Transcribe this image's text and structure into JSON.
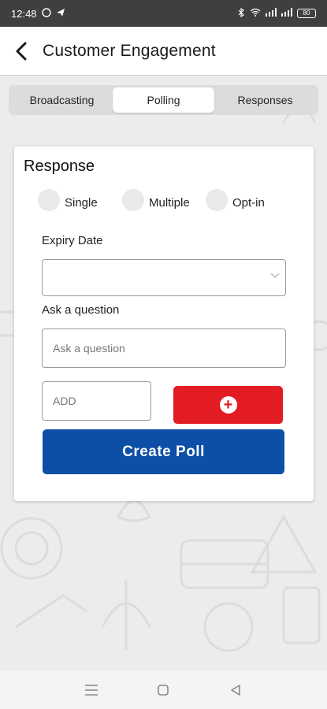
{
  "status_bar": {
    "time": "12:48",
    "battery": "80"
  },
  "header": {
    "title": "Customer Engagement"
  },
  "tabs": [
    {
      "label": "Broadcasting",
      "active": false
    },
    {
      "label": "Polling",
      "active": true
    },
    {
      "label": "Responses",
      "active": false
    }
  ],
  "form": {
    "title": "Response",
    "response_types": [
      {
        "label": "Single"
      },
      {
        "label": "Multiple"
      },
      {
        "label": "Opt-in"
      }
    ],
    "expiry_label": "Expiry Date",
    "expiry_value": "",
    "question_label": "Ask a question",
    "question_placeholder": "Ask a question",
    "add_placeholder": "ADD",
    "create_label": "Create Poll"
  },
  "colors": {
    "accent_red": "#e31b23",
    "primary_blue": "#0d4ea6"
  },
  "icons": {
    "back": "arrow-back-icon",
    "plus": "plus-circle-icon",
    "chevron": "chevron-down-icon"
  }
}
